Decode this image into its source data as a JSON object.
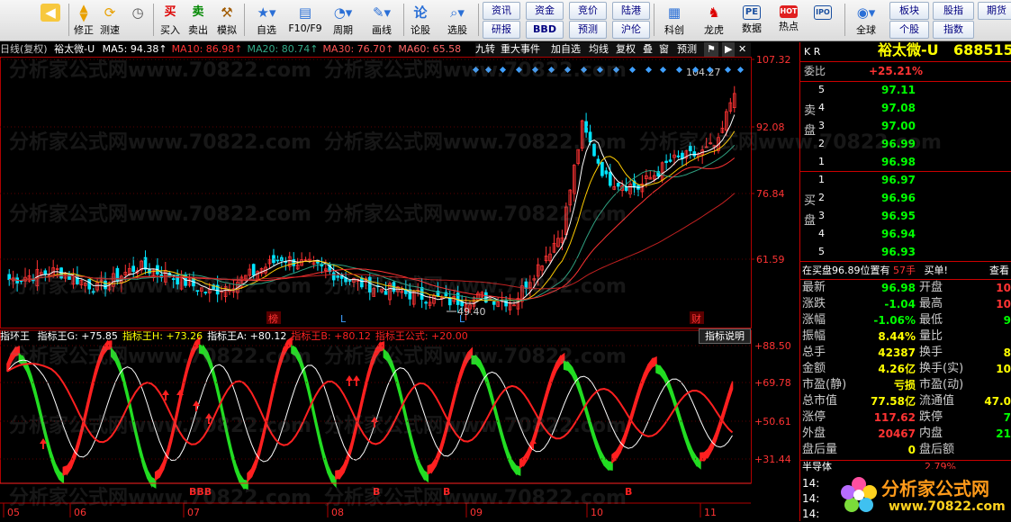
{
  "toolbar": {
    "buttons": [
      {
        "label": "",
        "icon": "back-arrow-icon"
      },
      {
        "label": "修正",
        "icon": "up-down-arrows-icon"
      },
      {
        "label": "测速",
        "icon": "refresh-icon"
      },
      {
        "label": "",
        "icon": "clock-icon"
      },
      {
        "label": "买入",
        "icon": "buy-icon",
        "glyph": "买"
      },
      {
        "label": "卖出",
        "icon": "sell-icon",
        "glyph": "卖"
      },
      {
        "label": "模拟",
        "icon": "hammer-icon"
      },
      {
        "label": "自选",
        "icon": "star-folder-icon"
      },
      {
        "label": "F10/F9",
        "icon": "f10-icon"
      },
      {
        "label": "周期",
        "icon": "cycle-icon"
      },
      {
        "label": "画线",
        "icon": "pen-icon"
      },
      {
        "label": "论股",
        "icon": "discuss-icon"
      },
      {
        "label": "选股",
        "icon": "magnifier-chart-icon"
      }
    ],
    "grid_buttons": [
      "资讯",
      "资金",
      "竞价",
      "陆港",
      "研报",
      "BBD",
      "预测",
      "沪伦"
    ],
    "right_buttons": [
      {
        "label": "科创",
        "icon": "chart-icon"
      },
      {
        "label": "龙虎",
        "icon": "dragon-icon"
      },
      {
        "label": "数据",
        "icon": "pe-icon",
        "glyph": "PE"
      },
      {
        "label": "热点",
        "icon": "hot-icon",
        "glyph": "HOT"
      },
      {
        "label": "全球",
        "icon": "globe-icon"
      }
    ],
    "far_right": [
      "板块",
      "股指",
      "期货",
      "个股",
      "指数"
    ],
    "ipo_icon_label": "IPO"
  },
  "chart": {
    "period": "日线(复权)",
    "name": "裕太微-U",
    "ma": [
      {
        "label": "MA5:",
        "value": "94.38↑",
        "color": "#ffffff"
      },
      {
        "label": "MA10:",
        "value": "86.98↑",
        "color": "#ff3333"
      },
      {
        "label": "MA20:",
        "value": "80.74↑",
        "color": "#33aa88"
      },
      {
        "label": "MA30:",
        "value": "76.70↑",
        "color": "#ff5555"
      },
      {
        "label": "MA60:",
        "value": "65.58",
        "color": "#ff6666"
      }
    ],
    "buttons": [
      "九转",
      "重大事件",
      "加自选",
      "均线",
      "复权",
      "叠",
      "窗",
      "预测"
    ],
    "price_labels": [
      "107.32",
      "92.08",
      "76.84",
      "61.59"
    ],
    "high_label": "104.27",
    "low_label": "49.40",
    "markers": [
      "榜",
      "L",
      "L",
      "财"
    ],
    "months": [
      "05",
      "06",
      "07",
      "08",
      "09",
      "10",
      "11"
    ]
  },
  "indicator": {
    "title": "指环王",
    "values": [
      {
        "label": "指标王G:",
        "value": "+75.85",
        "color": "#ffffff"
      },
      {
        "label": "指标王H:",
        "value": "+73.26",
        "color": "#ffff00"
      },
      {
        "label": "指标王A:",
        "value": "+80.12",
        "color": "#ffffff"
      },
      {
        "label": "指标王B:",
        "value": "+80.12",
        "color": "#ff2222"
      },
      {
        "label": "指标王公式:",
        "value": "+20.00",
        "color": "#ff2222"
      }
    ],
    "help_button": "指标说明",
    "levels": [
      "+88.50",
      "+69.78",
      "+50.61",
      "+31.44"
    ],
    "b_marks": [
      "BBB",
      "B",
      "B",
      "B"
    ]
  },
  "quote": {
    "market": "K R",
    "name": "裕太微-U",
    "code": "688515",
    "ratio_label": "委比",
    "ratio_value": "+25.21%",
    "sell_side": "卖盘",
    "buy_side": "买盘",
    "sell_levels": [
      {
        "level": "5",
        "price": "97.11"
      },
      {
        "level": "4",
        "price": "97.08"
      },
      {
        "level": "3",
        "price": "97.00"
      },
      {
        "level": "2",
        "price": "96.99"
      },
      {
        "level": "1",
        "price": "96.98"
      }
    ],
    "buy_levels": [
      {
        "level": "1",
        "price": "96.97"
      },
      {
        "level": "2",
        "price": "96.96"
      },
      {
        "level": "3",
        "price": "96.95"
      },
      {
        "level": "4",
        "price": "96.94"
      },
      {
        "level": "5",
        "price": "96.93"
      }
    ],
    "bid_info": "在买盘96.89位置有",
    "bid_qty": "57手",
    "bid_action": "买单!",
    "bid_more": "查看",
    "stats_left": [
      {
        "label": "最新",
        "value": "96.98",
        "color": "#00ff00"
      },
      {
        "label": "涨跌",
        "value": "-1.04",
        "color": "#00ff00"
      },
      {
        "label": "涨幅",
        "value": "-1.06%",
        "color": "#00ff00"
      },
      {
        "label": "振幅",
        "value": "8.44%",
        "color": "#ffff00"
      },
      {
        "label": "总手",
        "value": "42387",
        "color": "#ffff00"
      },
      {
        "label": "金额",
        "value": "4.26亿",
        "color": "#ffff00"
      },
      {
        "label": "市盈(静)",
        "value": "亏损",
        "color": "#ffff00"
      },
      {
        "label": "总市值",
        "value": "77.58亿",
        "color": "#ffff00"
      },
      {
        "label": "涨停",
        "value": "117.62",
        "color": "#ff3333"
      },
      {
        "label": "外盘",
        "value": "20467",
        "color": "#ff3333"
      },
      {
        "label": "盘后量",
        "value": "0",
        "color": "#ffff00"
      }
    ],
    "stats_right": [
      {
        "label": "开盘",
        "value": "10",
        "color": "#ff3333"
      },
      {
        "label": "最高",
        "value": "10",
        "color": "#ff3333"
      },
      {
        "label": "最低",
        "value": "9",
        "color": "#00ff00"
      },
      {
        "label": "量比",
        "value": "",
        "color": "#ffff00"
      },
      {
        "label": "换手",
        "value": "8",
        "color": "#ffff00"
      },
      {
        "label": "换手(实)",
        "value": "10",
        "color": "#ffff00"
      },
      {
        "label": "市盈(动)",
        "value": "",
        "color": "#ffff00"
      },
      {
        "label": "流通值",
        "value": "47.0",
        "color": "#ffff00"
      },
      {
        "label": "跌停",
        "value": "7",
        "color": "#00ff00"
      },
      {
        "label": "内盘",
        "value": "21",
        "color": "#00ff00"
      },
      {
        "label": "盘后额",
        "value": "",
        "color": "#ffff00"
      }
    ],
    "sector": "半导体",
    "sector_change": "2.79%",
    "times": [
      "14:",
      "14:",
      "14:"
    ]
  },
  "watermark": "分析家公式网www.70822.com",
  "logo": {
    "text": "分析家公式网",
    "url": "www.70822.com"
  }
}
